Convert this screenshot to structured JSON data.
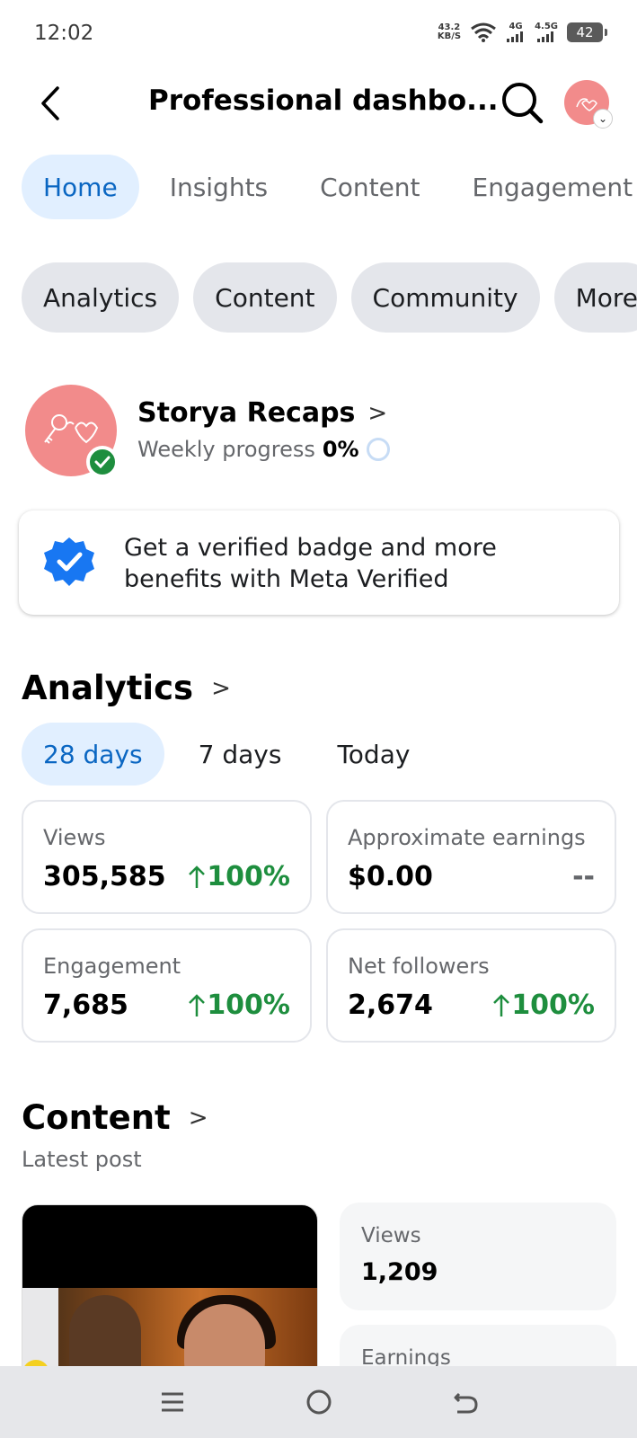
{
  "status_bar": {
    "time": "12:02",
    "net_speed_value": "43.2",
    "net_speed_unit": "KB/S",
    "sim1_label": "4G",
    "sim2_label": "4.5G",
    "battery": "42"
  },
  "header": {
    "title": "Professional dashbo..."
  },
  "tabs": [
    {
      "label": "Home",
      "active": true
    },
    {
      "label": "Insights",
      "active": false
    },
    {
      "label": "Content",
      "active": false
    },
    {
      "label": "Engagement",
      "active": false
    }
  ],
  "pills": [
    {
      "label": "Analytics"
    },
    {
      "label": "Content"
    },
    {
      "label": "Community"
    },
    {
      "label": "More"
    }
  ],
  "profile": {
    "name": "Storya Recaps",
    "progress_label": "Weekly progress",
    "progress_value": "0%"
  },
  "meta_card": {
    "text": "Get a verified badge and more benefits with Meta Verified",
    "badge_color": "#1877f2"
  },
  "analytics": {
    "title": "Analytics",
    "ranges": [
      {
        "label": "28 days",
        "active": true
      },
      {
        "label": "7 days",
        "active": false
      },
      {
        "label": "Today",
        "active": false
      }
    ],
    "metrics": [
      {
        "label": "Views",
        "value": "305,585",
        "change": "100%",
        "trend": "up"
      },
      {
        "label": "Approximate earnings",
        "value": "$0.00",
        "change": "--",
        "trend": "none"
      },
      {
        "label": "Engagement",
        "value": "7,685",
        "change": "100%",
        "trend": "up"
      },
      {
        "label": "Net followers",
        "value": "2,674",
        "change": "100%",
        "trend": "up"
      }
    ]
  },
  "content": {
    "title": "Content",
    "subtitle": "Latest post",
    "stats": [
      {
        "label": "Views",
        "value": "1,209"
      },
      {
        "label": "Earnings",
        "value": ""
      }
    ]
  },
  "colors": {
    "accent": "#0a66c2",
    "accent_bg": "#e1efff",
    "positive": "#1e8e3e",
    "avatar": "#f28b8b"
  }
}
